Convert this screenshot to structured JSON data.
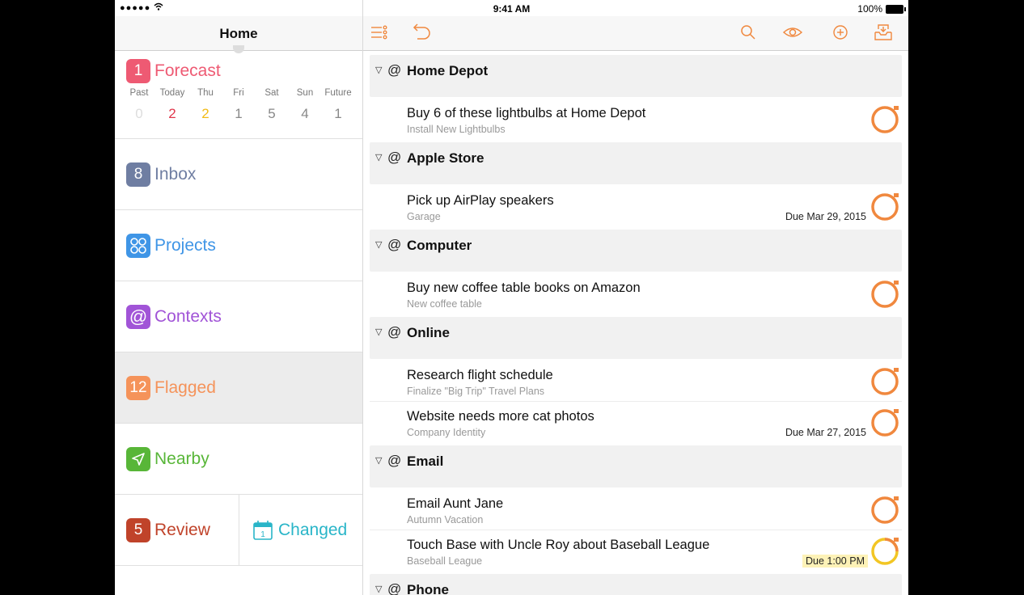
{
  "status": {
    "signal": "●●●●● ",
    "time": "9:41 AM",
    "battery": "100%"
  },
  "sidebar": {
    "title": "Home",
    "forecast": {
      "count": "1",
      "label": "Forecast",
      "days": [
        {
          "day": "Past",
          "num": "0",
          "color": "#dddddd"
        },
        {
          "day": "Today",
          "num": "2",
          "color": "#e0364b"
        },
        {
          "day": "Thu",
          "num": "2",
          "color": "#f2bb16"
        },
        {
          "day": "Fri",
          "num": "1",
          "color": "#888888"
        },
        {
          "day": "Sat",
          "num": "5",
          "color": "#888888"
        },
        {
          "day": "Sun",
          "num": "4",
          "color": "#888888"
        },
        {
          "day": "Future",
          "num": "1",
          "color": "#888888"
        }
      ]
    },
    "inbox": {
      "count": "8",
      "label": "Inbox"
    },
    "projects": {
      "label": "Projects"
    },
    "contexts": {
      "label": "Contexts"
    },
    "flagged": {
      "count": "12",
      "label": "Flagged"
    },
    "nearby": {
      "label": "Nearby"
    },
    "review": {
      "count": "5",
      "label": "Review"
    },
    "changed": {
      "label": "Changed",
      "calendar_day": "1"
    }
  },
  "colors": {
    "forecast": "#ee5a73",
    "inbox": "#6f7ea2",
    "projects": "#3f95e6",
    "contexts": "#a154d7",
    "flagged": "#f5935a",
    "nearby": "#58b638",
    "review": "#c0432a",
    "changed": "#29b5c8",
    "accent": "#f0883e"
  },
  "groups": [
    {
      "name": "Home Depot",
      "tasks": [
        {
          "title": "Buy 6 of these lightbulbs at Home Depot",
          "project": "Install New Lightbulbs",
          "due": ""
        }
      ]
    },
    {
      "name": "Apple Store",
      "tasks": [
        {
          "title": "Pick up AirPlay speakers",
          "project": "Garage",
          "due": "Due Mar 29, 2015"
        }
      ]
    },
    {
      "name": "Computer",
      "tasks": [
        {
          "title": "Buy new coffee table books on Amazon",
          "project": "New coffee table",
          "due": ""
        }
      ]
    },
    {
      "name": "Online",
      "tasks": [
        {
          "title": "Research flight schedule",
          "project": "Finalize \"Big Trip\" Travel Plans",
          "due": ""
        },
        {
          "title": "Website needs more cat photos",
          "project": "Company Identity",
          "due": "Due Mar 27, 2015"
        }
      ]
    },
    {
      "name": "Email",
      "tasks": [
        {
          "title": "Email Aunt Jane",
          "project": "Autumn Vacation",
          "due": ""
        },
        {
          "title": "Touch Base with Uncle Roy about Baseball League",
          "project": "Baseball League",
          "due": "Due 1:00 PM",
          "due_soon": true
        }
      ]
    },
    {
      "name": "Phone",
      "tasks": []
    }
  ],
  "icons": {
    "toolbar": [
      "list-settings-icon",
      "undo-icon",
      "search-icon",
      "perspective-eye-icon",
      "add-icon",
      "inbox-tray-icon"
    ]
  }
}
